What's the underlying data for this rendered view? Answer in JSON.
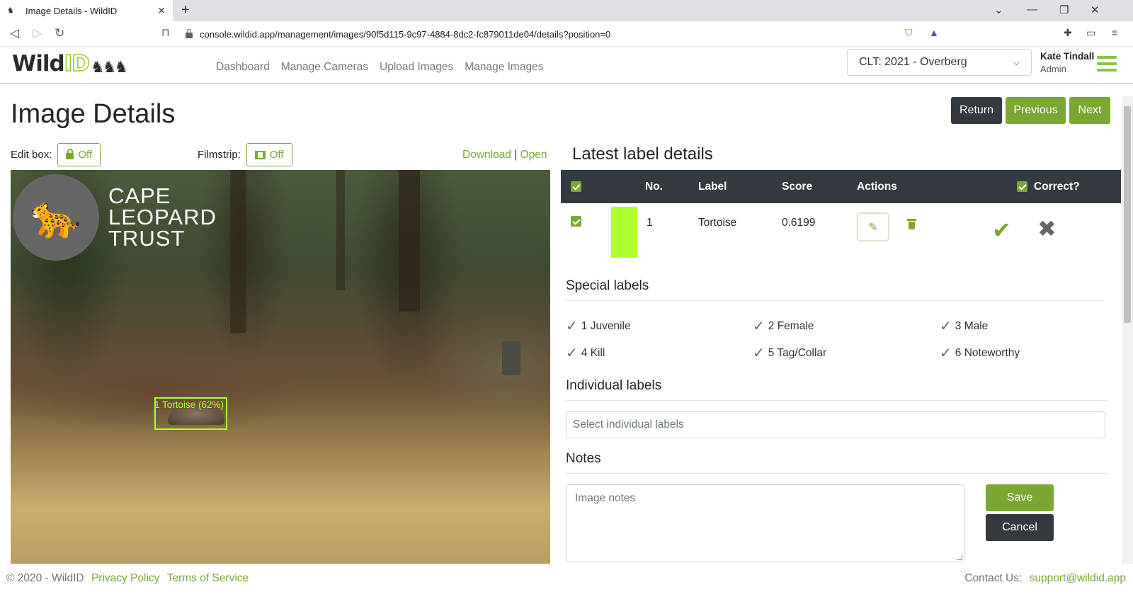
{
  "browser": {
    "tab_title": "Image Details - WildID",
    "url": "console.wildid.app/management/images/90f5d115-9c97-4884-8dc2-fc879011de04/details?position=0"
  },
  "header": {
    "logo_text_a": "Wild",
    "logo_text_b": "ID",
    "nav": [
      "Dashboard",
      "Manage Cameras",
      "Upload Images",
      "Manage Images"
    ],
    "project": "CLT: 2021 - Overberg",
    "user_name": "Kate Tindall",
    "user_role": "Admin"
  },
  "page": {
    "title": "Image Details",
    "return_label": "Return",
    "previous_label": "Previous",
    "next_label": "Next",
    "edit_box_label": "Edit box:",
    "edit_box_state": "Off",
    "filmstrip_label": "Filmstrip:",
    "filmstrip_state": "Off",
    "download_label": "Download",
    "open_label": "Open",
    "separator": "|"
  },
  "image": {
    "watermark_lines": [
      "CAPE",
      "LEOPARD",
      "TRUST"
    ],
    "box_label": "1 Tortoise (62%)"
  },
  "latest": {
    "title": "Latest label details",
    "columns": {
      "no": "No.",
      "label": "Label",
      "score": "Score",
      "actions": "Actions",
      "correct": "Correct?"
    },
    "rows": [
      {
        "no": "1",
        "label": "Tortoise",
        "score": "0.6199",
        "color": "#adff2f"
      }
    ]
  },
  "special": {
    "title": "Special labels",
    "items": [
      "1 Juvenile",
      "2 Female",
      "3 Male",
      "4 Kill",
      "5 Tag/Collar",
      "6 Noteworthy"
    ]
  },
  "individual": {
    "title": "Individual labels",
    "placeholder": "Select individual labels"
  },
  "notes": {
    "title": "Notes",
    "placeholder": "Image notes",
    "save_label": "Save",
    "cancel_label": "Cancel"
  },
  "footer": {
    "copyright": "© 2020 - WildID",
    "privacy": "Privacy Policy",
    "terms": "Terms of Service",
    "contact_label": "Contact Us:",
    "contact_email": "support@wildid.app"
  },
  "colors": {
    "accent": "#7aa832",
    "dark": "#343a40",
    "box": "#adff2f"
  }
}
